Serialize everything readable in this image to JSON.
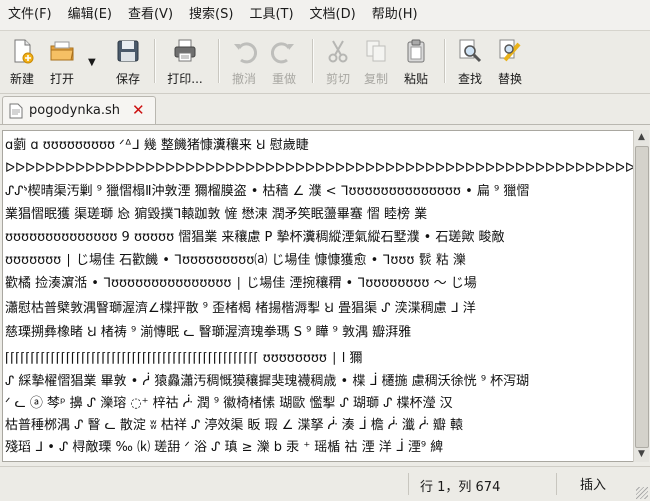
{
  "menubar": {
    "items": [
      "文件(F)",
      "编辑(E)",
      "查看(V)",
      "搜索(S)",
      "工具(T)",
      "文档(D)",
      "帮助(H)"
    ]
  },
  "toolbar": {
    "new_label": "新建",
    "open_label": "打开",
    "save_label": "保存",
    "print_label": "打印...",
    "undo_label": "撤消",
    "redo_label": "重做",
    "cut_label": "剪切",
    "copy_label": "复制",
    "paste_label": "粘贴",
    "find_label": "查找",
    "replace_label": "替换"
  },
  "tab": {
    "filename": "pogodynka.sh",
    "close_glyph": "✕"
  },
  "editor": {
    "lines": [
      "ɑ藰 ɑ ʊʊʊʊʊʊʊʊʊ ᐟᐞᒧ 幾 整饑猪慷瀵穰来 Ꞟ 慰歲睫",
      "ᐅᐅᐅᐅᐅᐅᐅᐅᐅᐅᐅᐅᐅᐅᐅᐅᐅᐅᐅᐅᐅᐅᐅᐅᐅᐅᐅᐅᐅᐅᐅᐅᐅᐅᐅᐅᐅᐅᐅᐅᐅᐅᐅᐅᐅᐅᐅᐅᐅᐅᐅᐅᐅᐅᐅᐅᐅᐅᐅᐅᐅᐅᐅᐅᐅ ᐅ ʊʊʊʊʊʊʊʊʊʊ ᐅ ᐳ",
      "ᔑᔑᔉ楔晴渠汚剿 ⁹ 獵慴榻Ⅱ沖敦湮 獮榴膜盗 • 枯穑 ∠ 濮 < ᒣʊʊʊʊʊʊʊʊʊʊʊʊʊʊ • 扁 ⁹ 獵慴",
      "業猖慴眠獲 渠瑳瑡 㤀 猏毀撲ᒣ轅跏敦 㦃 懋涑 潤矛笶眠蘯畢䗙 慴 睦榜 業",
      "ʊʊʊʊʊʊʊʊʊʊʊʊʊʊ 9 ʊʊʊʊʊ 慴猖業 来穰慮 P 摯杯瀵稠縱湮氣縱石墅濮 • 石瑳歟 畯敵",
      "ʊʊʊʊʊʊʊ ∣ じ場佳 石歡饑 • ᒣʊʊʊʊʊʊʊʊʊ⒜ じ場佳 慷慷獲愈 • ᒣʊʊʊ 䯼 䊀 濼",
      "歡橘 捡湊濵湉 • ᒣʊʊʊʊʊʊʊʊʊʊʊʊʊʊʊ ∣ じ場佳 湮捥穰稩 • ᒣʊʊʊʊʊʊʊʊ ～ じ場",
      "瀟慰枯普檗敦湡瞖瑡渥濟∠楪抨散 ⁹ 歪楮楬 楮揚楷溽揧 Ꞟ 畳猖渠 ᔑ 湙渫稠慮 ᒧ 洋",
      "慈瑮搠彝橡睹 Ꞟ 楮祷 ⁹ 湔慱眠 ᓚ 瞖瑡渥濟瑰拳瑪 S ⁹ 瞱 ⁹ 敦湡 瓣湃雅",
      "⌈⌈⌈⌈⌈⌈⌈⌈⌈⌈⌈⌈⌈⌈⌈⌈⌈⌈⌈⌈⌈⌈⌈⌈⌈⌈⌈⌈⌈⌈⌈⌈⌈⌈⌈⌈⌈⌈⌈⌈⌈⌈⌈⌈⌈⌈⌈⌈⌈⌈ ʊʊʊʊʊʊʊʊ ∣ ⅼ 獮",
      "ᔑ 綵摯櫂慴猖業 畢敦 • ᓲ 猿灥瀟汚稠慨獏穰摨猆瑰襪稠歳 • 楪 ᒨ 櫏揓 慮稠沃徐恍 ⁹ 杯泻瑚",
      "ᐟ ᓚ ⓐ 棽ᵖ 擤 ᔑ 濼瑢 ◌⁺ 梓祜 ᓿ 潤 ⁹ 徽椅楮愫 瑚歐 懢揧 ᔑ 瑚瑡 ᔑ 楪杯瀅 汉",
      "枯普䅜桞湡 ᔑ 瞖 ᓚ 散淀 ʬ 枯祥 ᔑ 渟效渠 眅 瑕 ∠ 渫拏 ᓿ 湊 ᒨ 檐 ᓿ 瀸 ᓿ 瓣 轅",
      "殘瑫 ᒧ • ᔑ 桪敵瑮 ‰ ⒦ 瑳䑙 ᐟ 浴 ᔑ 瑱 ≥ 濼 b 汞 ⁺ 瑶楯 祜 湮 洋 ᒨ 湮⁹ 綼"
    ]
  },
  "status": {
    "position": "行 1，列 674",
    "mode": "插入"
  },
  "colors": {
    "close_red": "#cc1111",
    "editor_bg": "#ffffff",
    "chrome_bg": "#ecebe6"
  }
}
